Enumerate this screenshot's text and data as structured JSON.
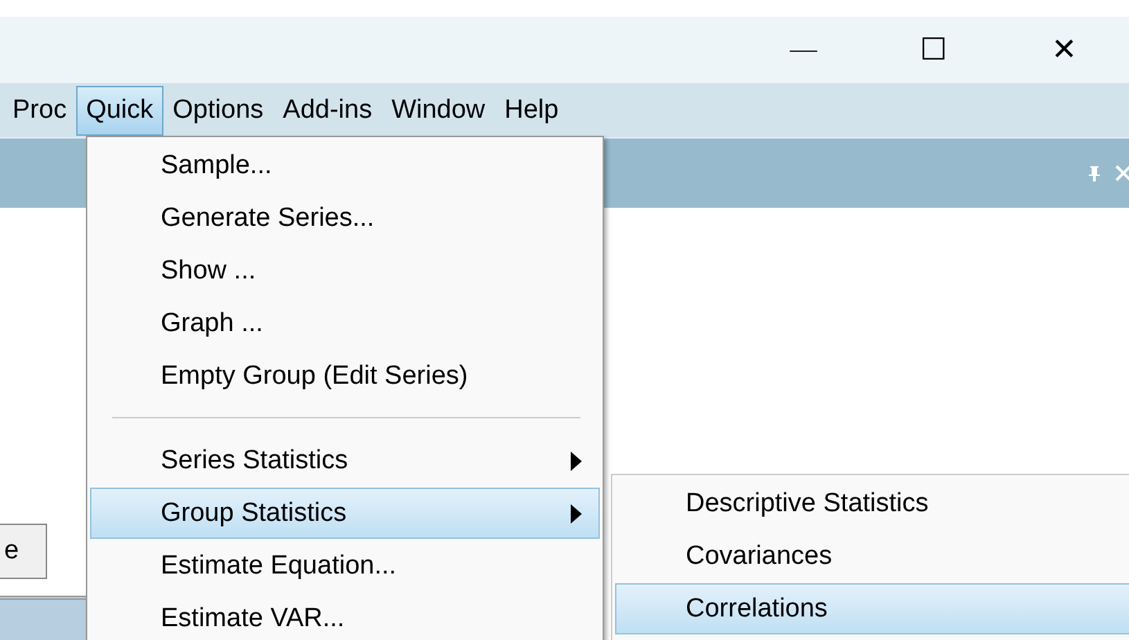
{
  "window_controls": [
    "—",
    "☐",
    "✕"
  ],
  "menubar": [
    {
      "label": "Proc",
      "selected": false
    },
    {
      "label": "Quick",
      "selected": true
    },
    {
      "label": "Options",
      "selected": false
    },
    {
      "label": "Add-ins",
      "selected": false
    },
    {
      "label": "Window",
      "selected": false
    },
    {
      "label": "Help",
      "selected": false
    }
  ],
  "panel": {
    "button_label": "e"
  },
  "menu": [
    {
      "kind": "item",
      "label": "Sample...",
      "submenu": false,
      "selected": false
    },
    {
      "kind": "item",
      "label": "Generate Series...",
      "submenu": false,
      "selected": false
    },
    {
      "kind": "item",
      "label": "Show ...",
      "submenu": false,
      "selected": false
    },
    {
      "kind": "item",
      "label": "Graph ...",
      "submenu": false,
      "selected": false
    },
    {
      "kind": "item",
      "label": "Empty Group (Edit Series)",
      "submenu": false,
      "selected": false
    },
    {
      "kind": "separator"
    },
    {
      "kind": "item",
      "label": "Series Statistics",
      "submenu": true,
      "selected": false
    },
    {
      "kind": "item",
      "label": "Group Statistics",
      "submenu": true,
      "selected": true
    },
    {
      "kind": "item",
      "label": "Estimate Equation...",
      "submenu": false,
      "selected": false
    },
    {
      "kind": "item",
      "label": "Estimate VAR...",
      "submenu": false,
      "selected": false
    }
  ],
  "submenu": [
    {
      "label": "Descriptive Statistics",
      "selected": false
    },
    {
      "label": "Covariances",
      "selected": false
    },
    {
      "label": "Correlations",
      "selected": true
    }
  ]
}
